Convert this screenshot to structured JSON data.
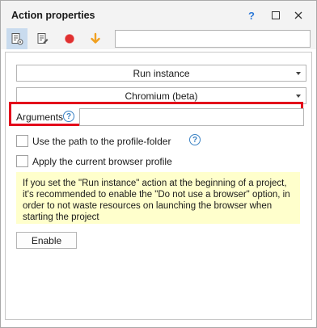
{
  "window": {
    "title": "Action properties",
    "help_label": "?"
  },
  "toolbar": {
    "tools": [
      {
        "icon": "properties-icon",
        "active": true
      },
      {
        "icon": "edit-icon",
        "active": false
      },
      {
        "icon": "record-icon",
        "active": false
      },
      {
        "icon": "arrow-down-icon",
        "active": false
      }
    ],
    "search_value": ""
  },
  "form": {
    "action_select": "Run instance",
    "browser_select": "Chromium (beta)",
    "arguments_label": "Arguments",
    "arguments_value": "",
    "help_glyph": "?",
    "checkbox_profile_path": {
      "label": "Use the path to the profile-folder",
      "checked": false
    },
    "checkbox_current_profile": {
      "label": "Apply the current browser profile",
      "checked": false
    },
    "note": "If you set the \"Run instance\" action at the beginning of a project,  it's recommended to enable the \"Do not use a browser\" option, in order to not waste resources on launching the browser when starting the project",
    "enable_label": "Enable"
  },
  "colors": {
    "highlight": "#e3001b",
    "note_background": "#ffffcc",
    "record": "#e03030",
    "arrow": "#f0a020",
    "help": "#3b82c4"
  }
}
